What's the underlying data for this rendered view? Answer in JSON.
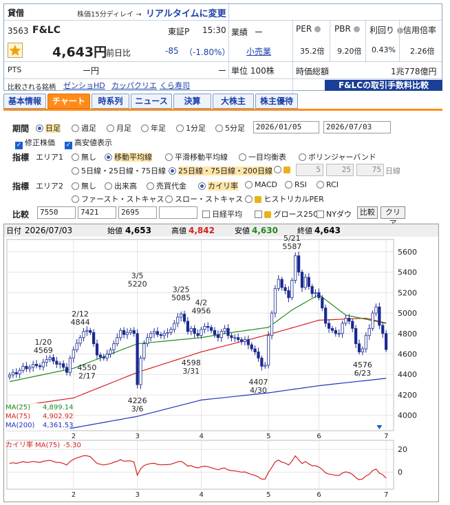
{
  "header": {
    "margin_label": "貸借",
    "delay_note": "株価15分ディレイ →",
    "realtime_link": "リアルタイムに変更",
    "code": "3563",
    "name": "F&LC",
    "market": "東証P",
    "time": "15:30",
    "price": "4,643円",
    "prev_label": "前日比",
    "change": "-85",
    "change_pct": "（-1.80%）",
    "pts_label": "PTS",
    "pts_price": "ー円",
    "pts_change": "ー",
    "industry_label": "業績",
    "industry_dash": "ー",
    "sector": "小売業",
    "unit": "単位 100株",
    "metrics": [
      {
        "label": "PER",
        "value": "35.2倍"
      },
      {
        "label": "PBR",
        "value": "9.20倍"
      },
      {
        "label": "利回り",
        "value": "0.43%"
      },
      {
        "label": "信用倍率",
        "value": "2.26倍"
      }
    ],
    "mcap_label": "時価総額",
    "mcap_value": "1兆778億円",
    "compare_label": "比較される銘柄",
    "compare_links": [
      "ゼンショHD",
      "カッパクリエ",
      "くら寿司"
    ],
    "fee_banner": "F&LCの取引手数料比較"
  },
  "tabs": [
    "基本情報",
    "チャート",
    "時系列",
    "ニュース",
    "決算",
    "大株主",
    "株主優待"
  ],
  "controls": {
    "period_label": "期間",
    "period_options": [
      "日足",
      "週足",
      "月足",
      "年足",
      "1分足",
      "5分足"
    ],
    "date_from": "2026/01/05",
    "date_to": "2026/07/03",
    "adj_label": "修正株価",
    "hilo_label": "高安値表示",
    "ind_label": "指標",
    "area1_label": "エリア1",
    "area1_options": [
      "無し",
      "移動平均線",
      "平滑移動平均線",
      "一目均衡表",
      "ボリンジャーバンド"
    ],
    "ma_sets": [
      "5日線・25日線・75日線",
      "25日線・75日線・200日線"
    ],
    "ma_custom": [
      "5",
      "25",
      "75"
    ],
    "ma_unit": "日線",
    "area2_label": "エリア2",
    "area2_row1": [
      "無し",
      "出来高",
      "売買代金",
      "カイリ率",
      "MACD",
      "RSI",
      "RCI"
    ],
    "area2_row2": [
      "ファースト・ストキャス",
      "スロー・ストキャス",
      "ヒストリカルPER"
    ],
    "cmp_label": "比較",
    "cmp_codes": [
      "7550",
      "7421",
      "2695",
      ""
    ],
    "cmp_checks": [
      "日経平均",
      "グロース250",
      "NYダウ"
    ],
    "cmp_btn": "比較",
    "clear_btn": "クリア"
  },
  "chart_info": {
    "date_label": "日付",
    "date": "2026/07/03",
    "open_label": "始値",
    "open": "4,653",
    "high_label": "高値",
    "high": "4,842",
    "low_label": "安値",
    "low": "4,630",
    "close_label": "終値",
    "close": "4,643",
    "ma_legend": [
      {
        "label": "MA(25)",
        "value": "4,899.14",
        "color": "#1f8a1f"
      },
      {
        "label": "MA(75)",
        "value": "4,902.92",
        "color": "#d42020"
      },
      {
        "label": "MA(200)",
        "value": "4,361.53",
        "color": "#2030c0"
      }
    ],
    "kairi_label": "カイリ率 MA(75)",
    "kairi_value": "-5.30"
  },
  "chart_data": {
    "type": "candlestick",
    "y_ticks": [
      4000,
      4200,
      4400,
      4600,
      4800,
      5000,
      5200,
      5400,
      5600
    ],
    "ylim": [
      3850,
      5720
    ],
    "x_ticks": [
      {
        "label": "2",
        "t": 19
      },
      {
        "label": "3",
        "t": 38
      },
      {
        "label": "4",
        "t": 57
      },
      {
        "label": "5",
        "t": 77
      },
      {
        "label": "6",
        "t": 92
      },
      {
        "label": "7",
        "t": 112
      }
    ],
    "t_max": 113,
    "close": [
      4395,
      4420,
      4405,
      4440,
      4480,
      4455,
      4470,
      4500,
      4485,
      4475,
      4520,
      4545,
      4565,
      4530,
      4500,
      4505,
      4470,
      4420,
      4560,
      4640,
      4705,
      4760,
      4820,
      4830,
      4810,
      4700,
      4590,
      4570,
      4560,
      4600,
      4640,
      4700,
      4760,
      4830,
      4790,
      4810,
      4830,
      4800,
      4300,
      4560,
      4700,
      4760,
      4800,
      4820,
      4790,
      4780,
      4800,
      4810,
      4840,
      4900,
      4960,
      4990,
      4920,
      4820,
      4850,
      4800,
      4780,
      4840,
      4870,
      4860,
      4830,
      4790,
      4760,
      4820,
      4850,
      4780,
      4760,
      4760,
      4740,
      4720,
      4740,
      4690,
      4650,
      4620,
      4560,
      4480,
      4490,
      4780,
      5000,
      5240,
      5330,
      5250,
      5220,
      5150,
      5320,
      5560,
      5400,
      5250,
      5350,
      5260,
      5190,
      5200,
      5150,
      5050,
      4900,
      4850,
      4830,
      4800,
      4800,
      4900,
      4950,
      4920,
      4850,
      4700,
      4620,
      4650,
      4780,
      4850,
      5000,
      5060,
      4880,
      4800,
      4643
    ],
    "kairi_ticks": [
      0,
      20
    ],
    "kairi_ylim": [
      -15,
      28
    ],
    "ma25_knots": [
      [
        0,
        4330
      ],
      [
        19,
        4460
      ],
      [
        38,
        4700
      ],
      [
        57,
        4760
      ],
      [
        66,
        4810
      ],
      [
        77,
        4860
      ],
      [
        84,
        5030
      ],
      [
        92,
        5180
      ],
      [
        100,
        4980
      ],
      [
        112,
        4899
      ]
    ],
    "ma75_knots": [
      [
        0,
        4080
      ],
      [
        19,
        4170
      ],
      [
        38,
        4420
      ],
      [
        57,
        4620
      ],
      [
        77,
        4790
      ],
      [
        92,
        4930
      ],
      [
        106,
        4950
      ],
      [
        112,
        4903
      ]
    ],
    "ma200_knots": [
      [
        16,
        3860
      ],
      [
        38,
        3990
      ],
      [
        57,
        4150
      ],
      [
        77,
        4220
      ],
      [
        92,
        4290
      ],
      [
        112,
        4362
      ]
    ],
    "hi_lo_labels": [
      {
        "t": 10,
        "date": "1/20",
        "value": "4569",
        "pos": "above"
      },
      {
        "t": 21,
        "date": "2/12",
        "value": "4844",
        "pos": "above"
      },
      {
        "t": 23,
        "date": "2/17",
        "value": "4550",
        "pos": "below"
      },
      {
        "t": 38,
        "date": "3/5",
        "value": "5220",
        "pos": "above"
      },
      {
        "t": 38,
        "date": "3/6",
        "value": "4226",
        "pos": "below"
      },
      {
        "t": 51,
        "date": "3/25",
        "value": "5085",
        "pos": "above"
      },
      {
        "t": 54,
        "date": "3/31",
        "value": "4598",
        "pos": "below"
      },
      {
        "t": 57,
        "date": "4/2",
        "value": "4956",
        "pos": "above"
      },
      {
        "t": 74,
        "date": "4/30",
        "value": "4407",
        "pos": "below"
      },
      {
        "t": 84,
        "date": "5/21",
        "value": "5587",
        "pos": "above"
      },
      {
        "t": 105,
        "date": "6/23",
        "value": "4576",
        "pos": "below"
      }
    ]
  }
}
